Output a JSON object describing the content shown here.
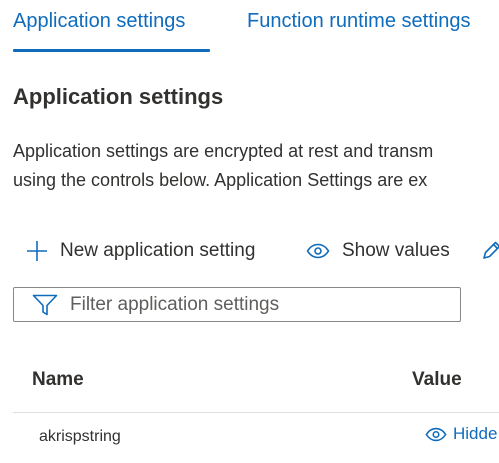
{
  "tabs": [
    {
      "label": "Application settings",
      "active": true
    },
    {
      "label": "Function runtime settings",
      "active": false
    }
  ],
  "section": {
    "title": "Application settings",
    "description_line1": "Application settings are encrypted at rest and transm",
    "description_line2": "using the controls below. Application Settings are ex"
  },
  "toolbar": {
    "new_label": "New application setting",
    "new_icon": "plus-icon",
    "show_label": "Show values",
    "show_icon": "eye-icon",
    "edit_icon": "pencil-icon"
  },
  "filter": {
    "placeholder": "Filter application settings",
    "value": "",
    "icon": "filter-icon"
  },
  "table": {
    "columns": [
      "Name",
      "Value"
    ],
    "rows": [
      {
        "name": "akrispstring",
        "value": "Hidde",
        "value_icon": "eye-icon"
      }
    ]
  },
  "colors": {
    "accent": "#0f6cbd",
    "text": "#323130",
    "border": "#8a8886",
    "divider": "#e1dfdd"
  }
}
